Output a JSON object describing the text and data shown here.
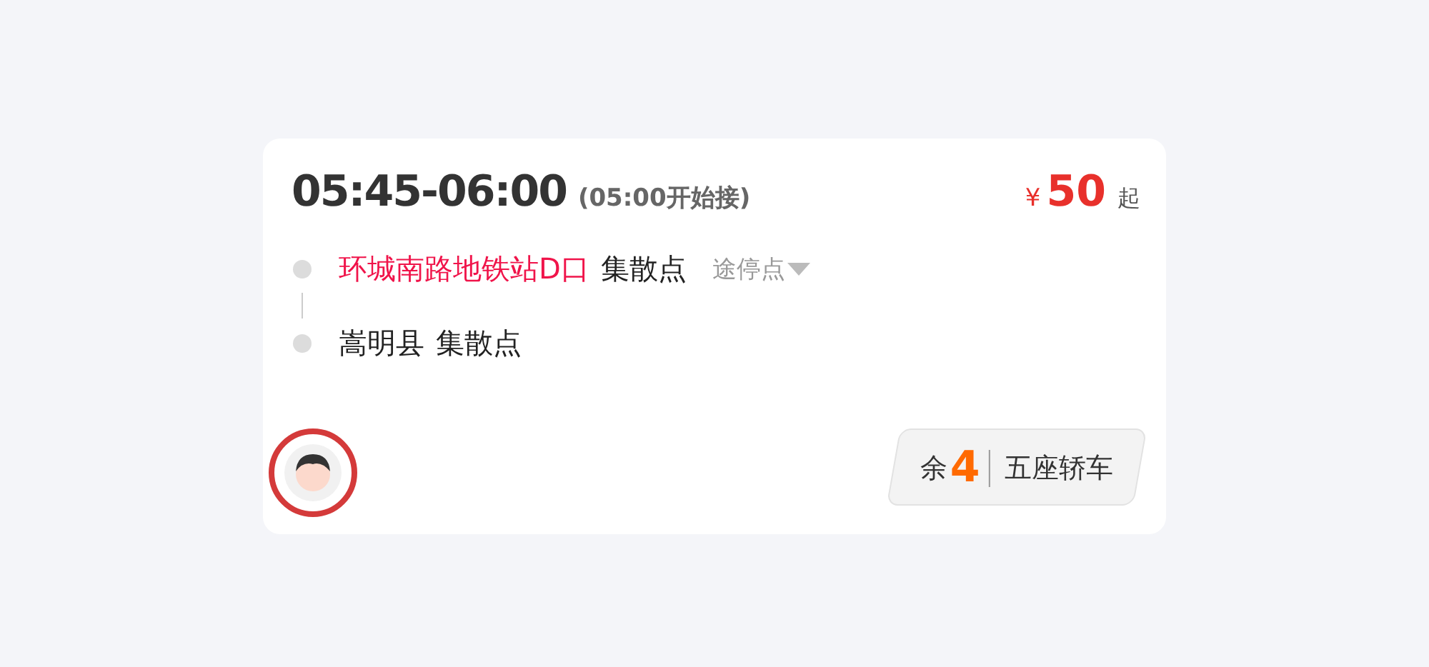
{
  "trip": {
    "time": "05:45-06:00",
    "pickup_note": "(05:00开始接)",
    "currency": "¥",
    "price": "50",
    "price_suffix": "起"
  },
  "stops": [
    {
      "name": "环城南路地铁站D口",
      "highlight": true,
      "tag": "集散点",
      "via": "途停点"
    },
    {
      "name": "嵩明县",
      "highlight": false,
      "tag": "集散点"
    }
  ],
  "driver": {
    "highlighted": true
  },
  "seats": {
    "prefix": "余",
    "count": "4",
    "vehicle": "五座轿车"
  }
}
